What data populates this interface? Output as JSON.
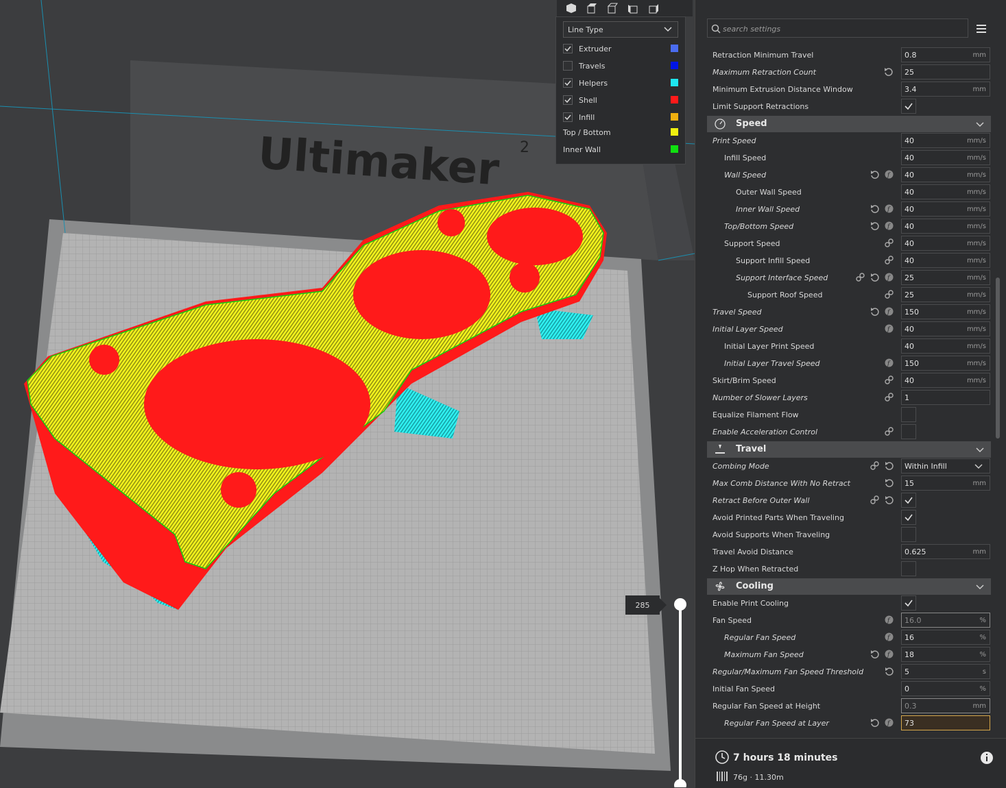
{
  "viewport": {
    "brand": "Ultimaker",
    "brand_suffix": "2",
    "layer_value": "285",
    "view_buttons": [
      "3d-view-icon",
      "front-view-icon",
      "top-view-icon",
      "left-view-icon",
      "right-view-icon"
    ]
  },
  "legend": {
    "line_type": "Line Type",
    "items": [
      {
        "label": "Extruder",
        "checked": true,
        "color": "#4a6cf0"
      },
      {
        "label": "Travels",
        "checked": false,
        "color": "#0015e6"
      },
      {
        "label": "Helpers",
        "checked": true,
        "color": "#1ee6f0"
      },
      {
        "label": "Shell",
        "checked": true,
        "color": "#ff1a1a"
      },
      {
        "label": "Infill",
        "checked": true,
        "color": "#f0b010"
      },
      {
        "label": "Top / Bottom",
        "color": "#f0f010"
      },
      {
        "label": "Inner Wall",
        "color": "#10e010"
      }
    ]
  },
  "search": {
    "placeholder": "search settings"
  },
  "settings": {
    "retraction_min_travel": {
      "label": "Retraction Minimum Travel",
      "value": "0.8",
      "unit": "mm"
    },
    "max_retraction_count": {
      "label": "Maximum Retraction Count",
      "value": "25"
    },
    "min_extrusion_window": {
      "label": "Minimum Extrusion Distance Window",
      "value": "3.4",
      "unit": "mm"
    },
    "limit_support_retractions": {
      "label": "Limit Support Retractions"
    },
    "speed": {
      "title": "Speed",
      "print_speed": {
        "label": "Print Speed",
        "value": "40",
        "unit": "mm/s"
      },
      "infill_speed": {
        "label": "Infill Speed",
        "value": "40",
        "unit": "mm/s"
      },
      "wall_speed": {
        "label": "Wall Speed",
        "value": "40",
        "unit": "mm/s"
      },
      "outer_wall_speed": {
        "label": "Outer Wall Speed",
        "value": "40",
        "unit": "mm/s"
      },
      "inner_wall_speed": {
        "label": "Inner Wall Speed",
        "value": "40",
        "unit": "mm/s"
      },
      "top_bottom_speed": {
        "label": "Top/Bottom Speed",
        "value": "40",
        "unit": "mm/s"
      },
      "support_speed": {
        "label": "Support Speed",
        "value": "40",
        "unit": "mm/s"
      },
      "support_infill_speed": {
        "label": "Support Infill Speed",
        "value": "40",
        "unit": "mm/s"
      },
      "support_interface_speed": {
        "label": "Support Interface Speed",
        "value": "25",
        "unit": "mm/s"
      },
      "support_roof_speed": {
        "label": "Support Roof Speed",
        "value": "25",
        "unit": "mm/s"
      },
      "travel_speed": {
        "label": "Travel Speed",
        "value": "150",
        "unit": "mm/s"
      },
      "initial_layer_speed": {
        "label": "Initial Layer Speed",
        "value": "40",
        "unit": "mm/s"
      },
      "initial_layer_print_speed": {
        "label": "Initial Layer Print Speed",
        "value": "40",
        "unit": "mm/s"
      },
      "initial_layer_travel_speed": {
        "label": "Initial Layer Travel Speed",
        "value": "150",
        "unit": "mm/s"
      },
      "skirt_brim_speed": {
        "label": "Skirt/Brim Speed",
        "value": "40",
        "unit": "mm/s"
      },
      "number_slower_layers": {
        "label": "Number of Slower Layers",
        "value": "1"
      },
      "equalize_flow": {
        "label": "Equalize Filament Flow"
      },
      "accel_control": {
        "label": "Enable Acceleration Control"
      }
    },
    "travel": {
      "title": "Travel",
      "combing_mode": {
        "label": "Combing Mode",
        "value": "Within Infill"
      },
      "max_comb_distance": {
        "label": "Max Comb Distance With No Retract",
        "value": "15",
        "unit": "mm"
      },
      "retract_before_outer": {
        "label": "Retract Before Outer Wall"
      },
      "avoid_printed": {
        "label": "Avoid Printed Parts When Traveling"
      },
      "avoid_supports": {
        "label": "Avoid Supports When Traveling"
      },
      "travel_avoid_distance": {
        "label": "Travel Avoid Distance",
        "value": "0.625",
        "unit": "mm"
      },
      "z_hop": {
        "label": "Z Hop When Retracted"
      }
    },
    "cooling": {
      "title": "Cooling",
      "enable_cooling": {
        "label": "Enable Print Cooling"
      },
      "fan_speed": {
        "label": "Fan Speed",
        "value": "16.0",
        "unit": "%"
      },
      "regular_fan_speed": {
        "label": "Regular Fan Speed",
        "value": "16",
        "unit": "%"
      },
      "max_fan_speed": {
        "label": "Maximum Fan Speed",
        "value": "18",
        "unit": "%"
      },
      "fan_threshold": {
        "label": "Regular/Maximum Fan Speed Threshold",
        "value": "5",
        "unit": "s"
      },
      "initial_fan_speed": {
        "label": "Initial Fan Speed",
        "value": "0",
        "unit": "%"
      },
      "fan_speed_height": {
        "label": "Regular Fan Speed at Height",
        "value": "0.3",
        "unit": "mm"
      },
      "fan_speed_layer": {
        "label": "Regular Fan Speed at Layer",
        "value": "73"
      }
    }
  },
  "footer": {
    "time": "7 hours 18 minutes",
    "material": "76g · 11.30m"
  }
}
